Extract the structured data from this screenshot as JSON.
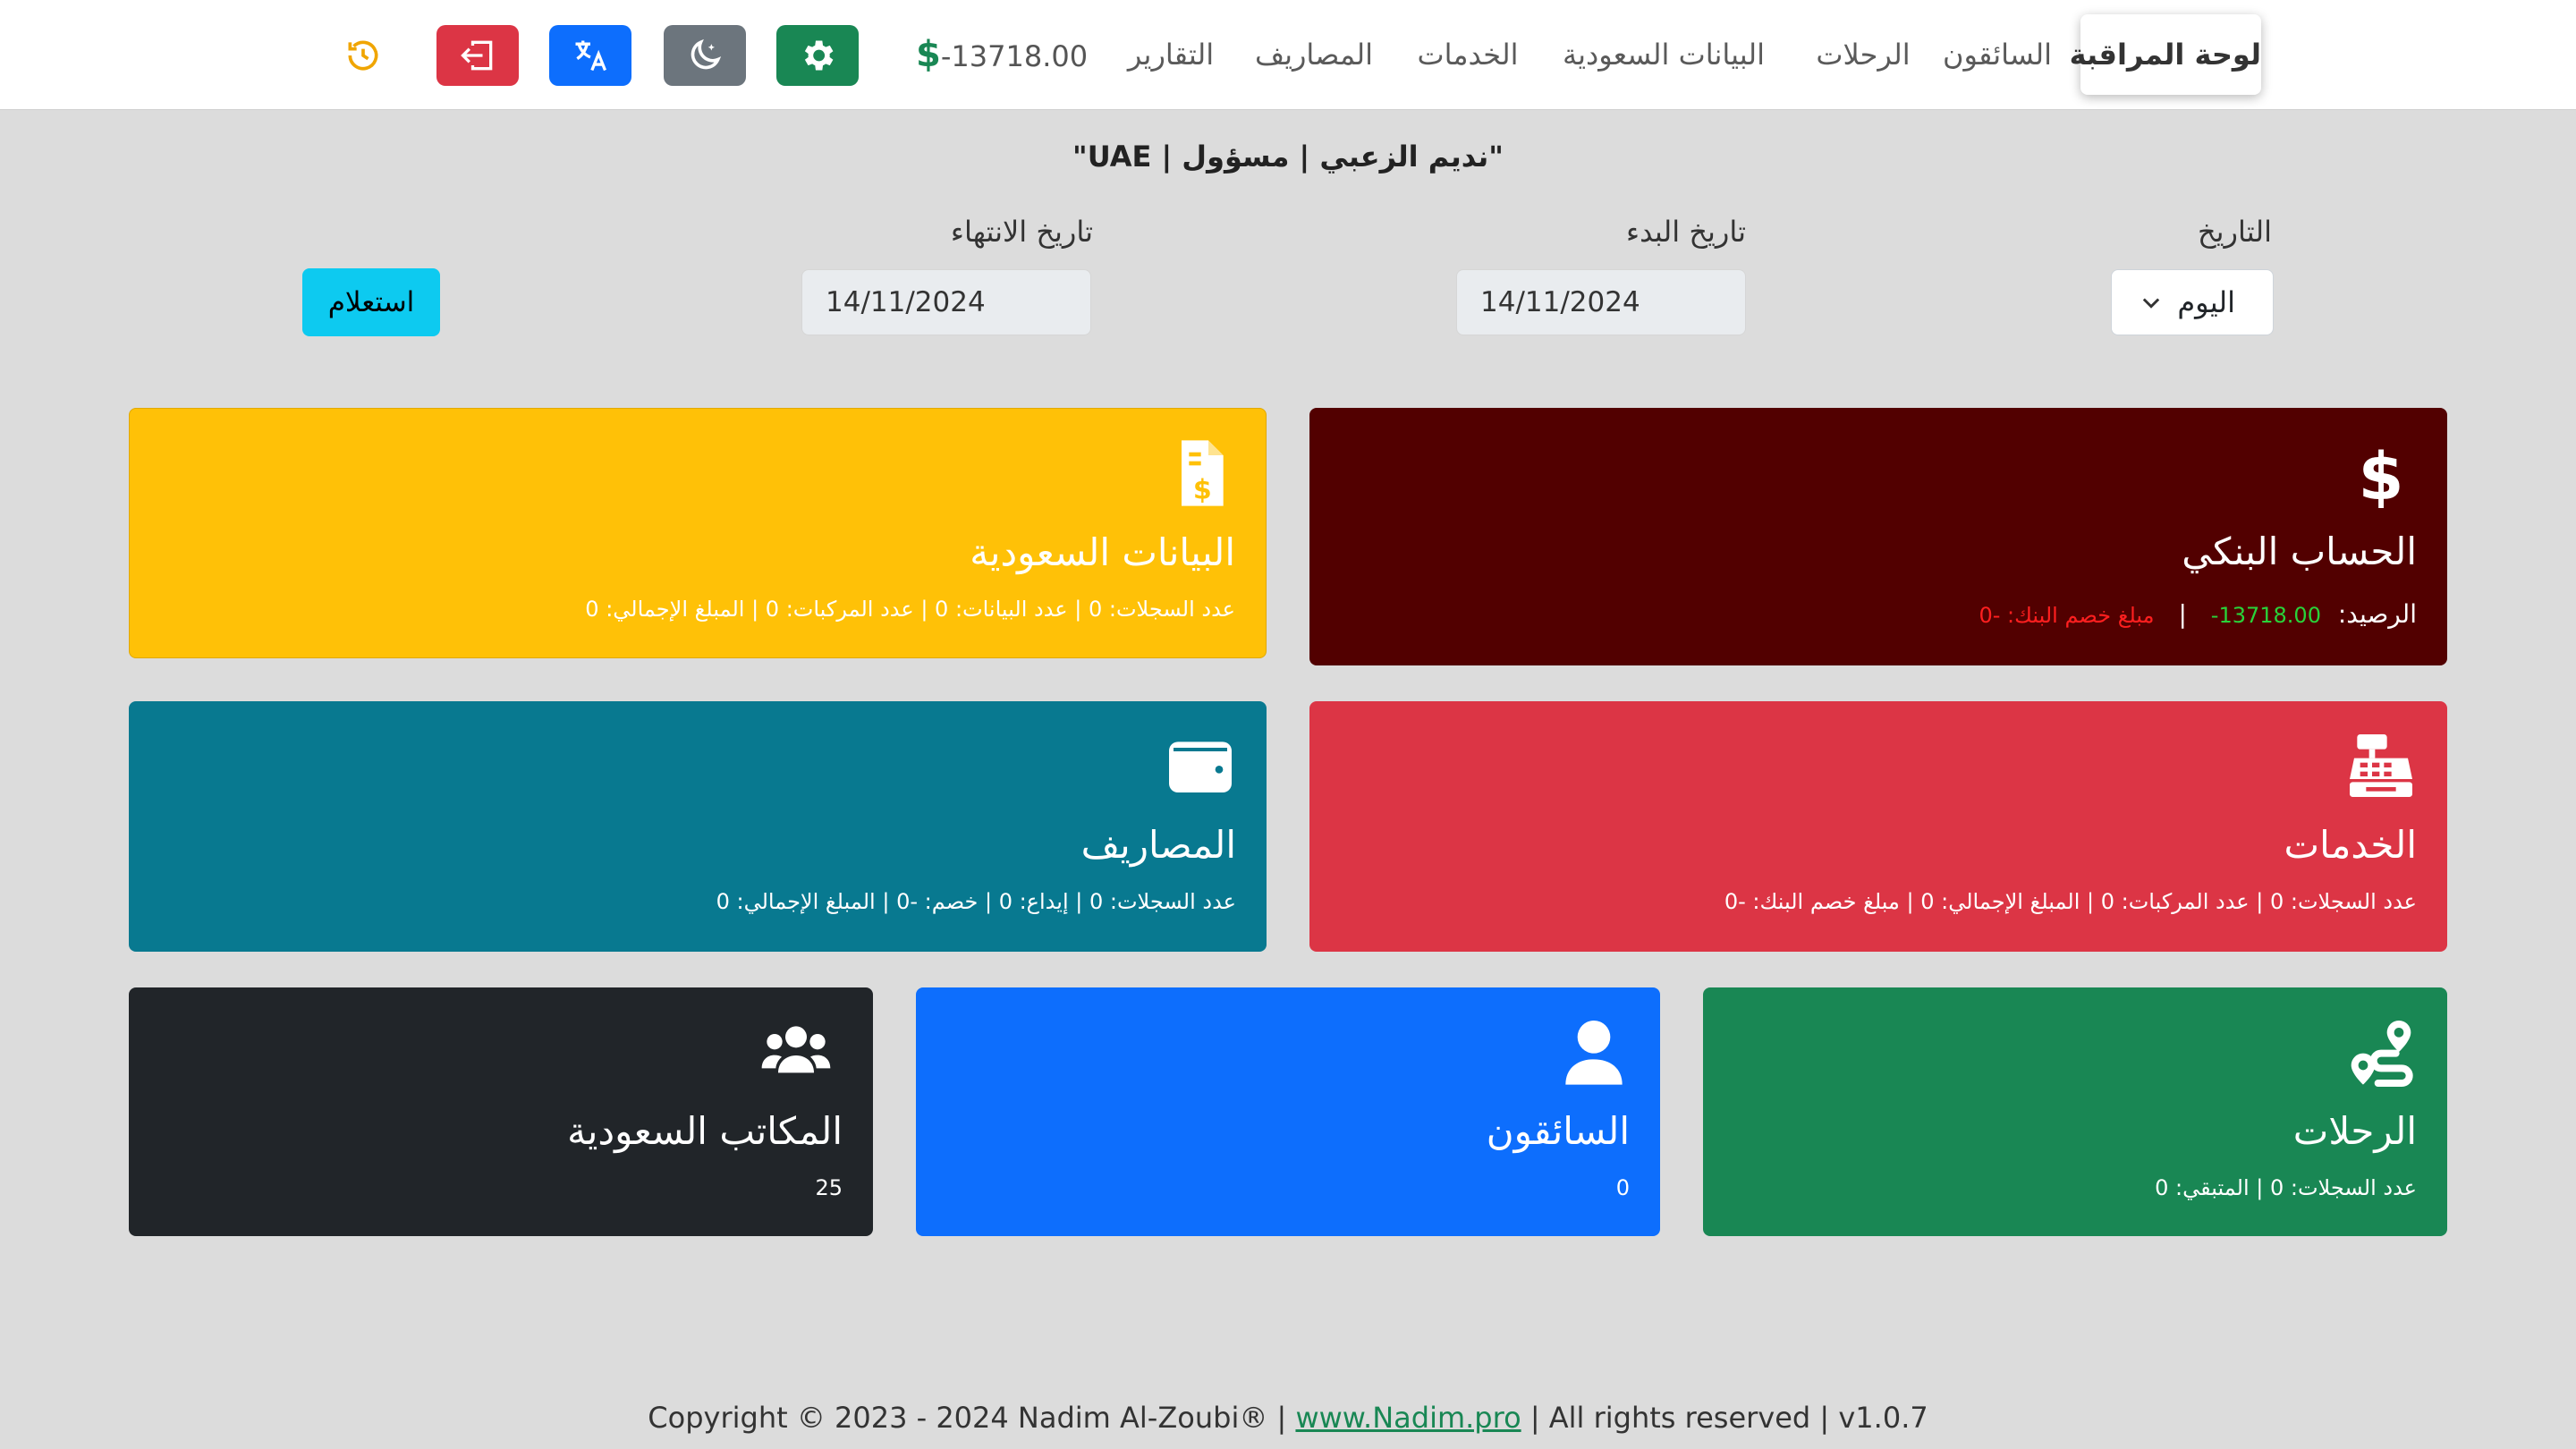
{
  "nav": {
    "items": [
      {
        "label": "لوحة المراقبة",
        "active": true
      },
      {
        "label": "السائقون"
      },
      {
        "label": "الرحلات"
      },
      {
        "label": "البيانات السعودية"
      },
      {
        "label": "الخدمات"
      },
      {
        "label": "المصاريف"
      },
      {
        "label": "التقارير"
      }
    ],
    "balance": "-13718.00",
    "buttons": [
      {
        "name": "settings",
        "icon": "gear-icon",
        "color": "#198754"
      },
      {
        "name": "dark-mode",
        "icon": "moon-icon",
        "color": "#6c757d"
      },
      {
        "name": "language",
        "icon": "translate-icon",
        "color": "#0d6efd"
      },
      {
        "name": "logout",
        "icon": "logout-icon",
        "color": "#dc3545"
      },
      {
        "name": "history",
        "icon": "history-icon",
        "color": "#ffc107"
      }
    ]
  },
  "header": {
    "title": "\"نديم الزعبي | مسؤول | UAE\""
  },
  "filters": {
    "date_label": "التاريخ",
    "date_value": "اليوم",
    "start_label": "تاريخ البدء",
    "start_value": "14/11/2024",
    "end_label": "تاريخ الانتهاء",
    "end_value": "14/11/2024",
    "query_button": "استعلام"
  },
  "cards": {
    "bank": {
      "title": "الحساب البنكي",
      "balance_label": "الرصيد:",
      "balance_value": "-13718.00",
      "deduct_text": "مبلغ خصم البنك: -0",
      "separator": "|",
      "color": "#520000"
    },
    "saudi_data": {
      "title": "البيانات السعودية",
      "sub": "عدد السجلات: 0 | عدد البيانات: 0 | عدد المركبات: 0 | المبلغ الإجمالي: 0",
      "color": "#ffc107"
    },
    "services": {
      "title": "الخدمات",
      "sub": "عدد السجلات: 0 | عدد المركبات: 0 | المبلغ الإجمالي: 0 | مبلغ خصم البنك: -0",
      "color": "#dc3545"
    },
    "expenses": {
      "title": "المصاريف",
      "sub": "عدد السجلات: 0 | إيداع: 0 | خصم: -0 | المبلغ الإجمالي: 0",
      "color": "#087990"
    },
    "trips": {
      "title": "الرحلات",
      "sub": "عدد السجلات: 0 | المتبقي: 0",
      "color": "#198754"
    },
    "drivers": {
      "title": "السائقون",
      "sub": "0",
      "color": "#0d6efd"
    },
    "offices": {
      "title": "المكاتب السعودية",
      "sub": "25",
      "color": "#212529"
    }
  },
  "footer": {
    "prefix": "Copyright © 2023 - 2024 Nadim Al-Zoubi® | ",
    "link": "www.Nadim.pro",
    "suffix": " | All rights reserved | v1.0.7"
  }
}
